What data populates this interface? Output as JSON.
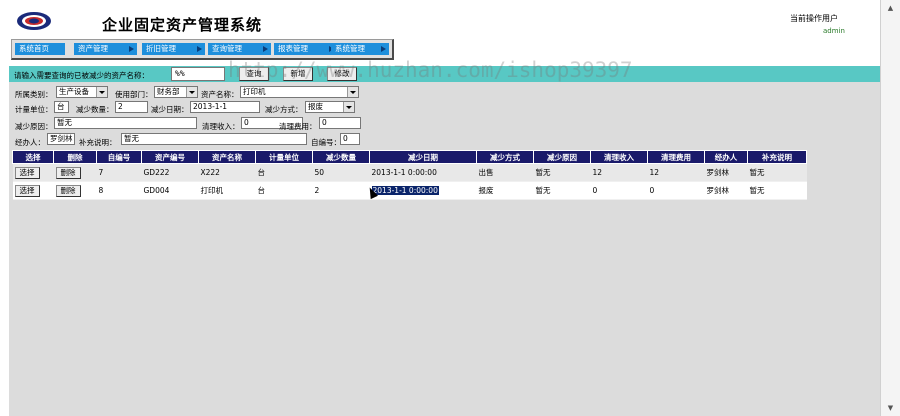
{
  "header": {
    "title": "企业固定资产管理系统",
    "user_label": "当前操作用户",
    "user_name": "admin"
  },
  "nav": [
    "系统首页",
    "资产管理",
    "折旧管理",
    "查询管理",
    "报表管理",
    "系统管理"
  ],
  "search": {
    "label": "请输入需要查询的已被减少的资产名称：",
    "value": "%%",
    "query_button": "查询",
    "add_button": "新增",
    "modify_button": "修改"
  },
  "form": {
    "category_label": "所属类别：",
    "category_value": "生产设备",
    "dept_label": "使用部门：",
    "dept_value": "财务部",
    "asset_label": "资产名称：",
    "asset_value": "打印机",
    "unit_label": "计量单位：",
    "unit_value": "台",
    "qty_label": "减少数量：",
    "qty_value": "2",
    "date_label": "减少日期：",
    "date_value": "2013-1-1",
    "method_label": "减少方式：",
    "method_value": "报废",
    "reason_label": "减少原因：",
    "reason_value": "暂无",
    "income_label": "清理收入：",
    "income_value": "0",
    "cost_label": "清理费用：",
    "cost_value": "0",
    "handler_label": "经办人：",
    "handler_value": "罗剑林",
    "note_label": "补充说明：",
    "note_value": "暂无",
    "id_label": "自编号：",
    "id_value": "0"
  },
  "table": {
    "headers": [
      "选择",
      "删除",
      "自编号",
      "资产编号",
      "资产名称",
      "计量单位",
      "减少数量",
      "减少日期",
      "减少方式",
      "减少原因",
      "清理收入",
      "清理费用",
      "经办人",
      "补充说明"
    ],
    "select_label": "选择",
    "delete_label": "删除",
    "rows": [
      [
        "7",
        "GD222",
        "X222",
        "台",
        "50",
        "2013-1-1 0:00:00",
        "出售",
        "暂无",
        "12",
        "12",
        "罗剑林",
        "暂无"
      ],
      [
        "8",
        "GD004",
        "打印机",
        "台",
        "2",
        "2013-1-1 0:00:00",
        "报废",
        "暂无",
        "0",
        "0",
        "罗剑林",
        "暂无"
      ]
    ]
  },
  "watermark": "http://www.huzhan.com/ishop39397",
  "colors": {
    "nav_blue": "#1e8fdc",
    "search_teal": "#58c8c4",
    "table_header": "#1a1a6a",
    "form_gray": "#dcdcdc"
  }
}
